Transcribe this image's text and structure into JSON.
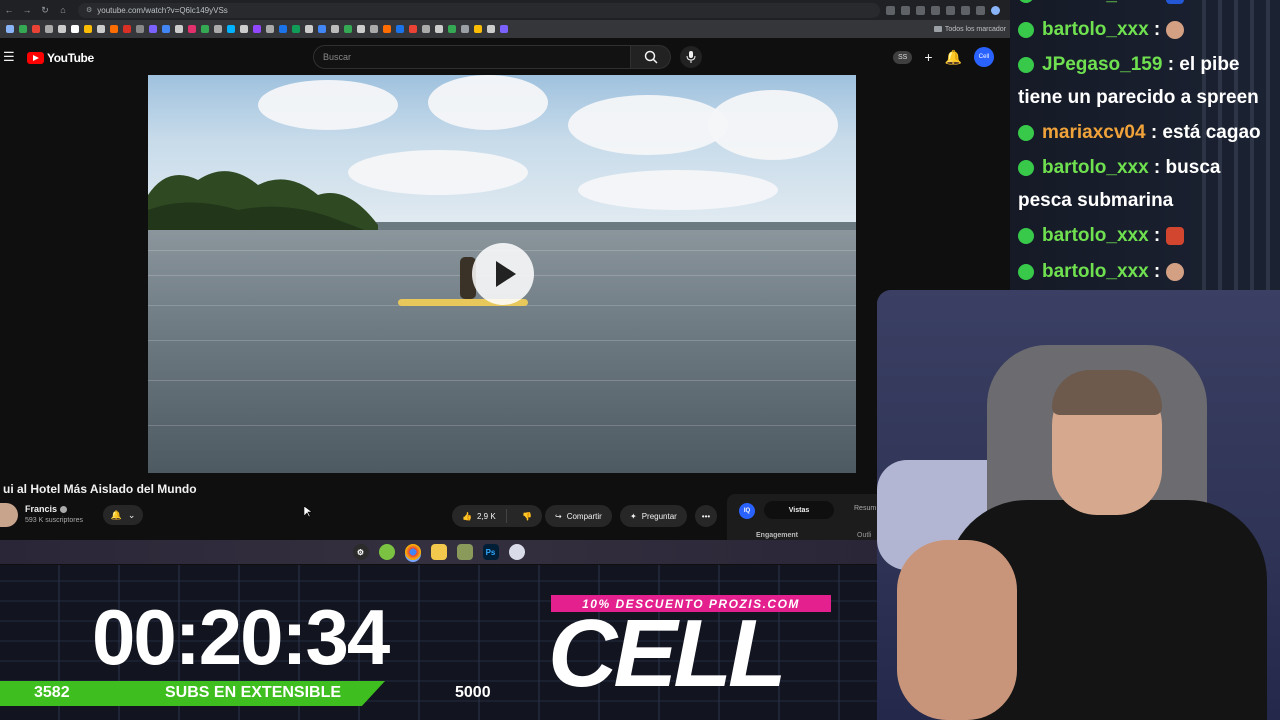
{
  "browser": {
    "url": "youtube.com/watch?v=Q6lc149yVSs",
    "bookmarks_all_label": "Todos los marcador"
  },
  "youtube": {
    "logo_text": "YouTube",
    "search_placeholder": "Buscar",
    "account_badge": "SS",
    "avatar_text": "Cell"
  },
  "video": {
    "title": "ui al Hotel Más Aislado del Mundo",
    "channel": "Francis",
    "subscribers": "593 K suscriptores",
    "likes": "2,9 K",
    "share_label": "Compartir",
    "ask_label": "Preguntar"
  },
  "side_panel": {
    "badge": "IQ",
    "tab_active": "Vistas",
    "tab_other": "Resum",
    "label_left": "Engagement",
    "label_right": "Outli"
  },
  "overlay": {
    "timer": "00:20:34",
    "subs_current": "3582",
    "subs_label": "SUBS EN EXTENSIBLE",
    "subs_goal": "5000",
    "subs_progress": 0.72,
    "promo": "10% DESCUENTO PROZIS.COM",
    "logo": "CELL"
  },
  "chat": {
    "messages": [
      {
        "user": "bartolo_xxx",
        "text": " :",
        "emote": true
      },
      {
        "user": "JPegaso_159",
        "text": " : el pibe"
      },
      {
        "continuation": "tiene un parecido a spreen"
      },
      {
        "user": "mariaxcv04",
        "text": " : está cagao",
        "orange": true
      },
      {
        "user": "bartolo_xxx",
        "text": " : busca"
      },
      {
        "continuation": "pesca submarina"
      },
      {
        "user": "bartolo_xxx",
        "text": " :",
        "emote": true
      },
      {
        "user": "bartolo_xxx",
        "text": " :",
        "emote": true
      }
    ]
  },
  "colors": {
    "accent_green": "#3fbf1f",
    "promo_pink": "#e3208e",
    "youtube_red": "#ff0000"
  }
}
